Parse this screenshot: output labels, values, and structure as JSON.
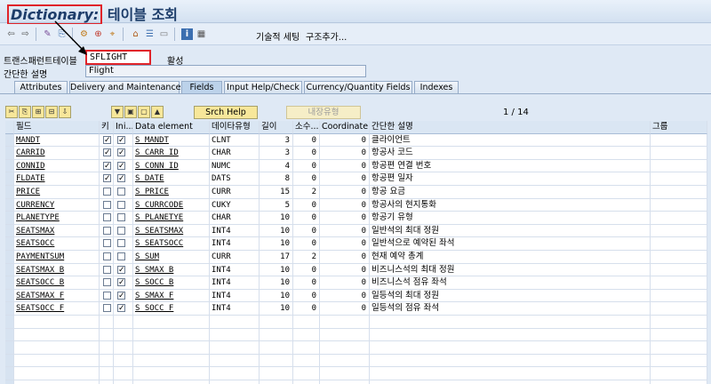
{
  "title": {
    "highlighted": "Dictionary:",
    "rest": " 테이블 조회"
  },
  "toolbar": {
    "icons": [
      "back-arrow-icon",
      "forward-arrow-icon",
      "edit-pen-icon",
      "display-change-icon",
      "activate-icon",
      "where-used-icon",
      "hierarchy-icon",
      "object-list-icon",
      "display-object-icon",
      "info-icon",
      "table-view-icon"
    ],
    "technical_settings": "기술적 세팅",
    "append_structure": "구조추가..."
  },
  "header_fields": {
    "transparent_table_label": "트랜스패런트테이블",
    "transparent_table_value": "SFLIGHT",
    "status": "활성",
    "short_desc_label": "간단한 설명",
    "short_desc_value": "Flight"
  },
  "tabs": [
    "Attributes",
    "Delivery and Maintenance",
    "Fields",
    "Input Help/Check",
    "Currency/Quantity Fields",
    "Indexes"
  ],
  "active_tab": "Fields",
  "table_toolbar": {
    "srch_help": "Srch Help",
    "builtin_type": "내장유형",
    "paging": "1  /  14"
  },
  "columns": [
    "필드",
    "키",
    "Ini...",
    "Data element",
    "데이타유형",
    "길이",
    "소수...",
    "Coordinate",
    "간단한 설명",
    "그룹"
  ],
  "rows": [
    {
      "field": "MANDT",
      "key": true,
      "init": true,
      "element": "S_MANDT",
      "type": "CLNT",
      "length": "3",
      "decimals": "0",
      "coord": "0",
      "desc": "클라이언트"
    },
    {
      "field": "CARRID",
      "key": true,
      "init": true,
      "element": "S_CARR_ID",
      "type": "CHAR",
      "length": "3",
      "decimals": "0",
      "coord": "0",
      "desc": "항공사 코드"
    },
    {
      "field": "CONNID",
      "key": true,
      "init": true,
      "element": "S_CONN_ID",
      "type": "NUMC",
      "length": "4",
      "decimals": "0",
      "coord": "0",
      "desc": "항공편 연결 번호"
    },
    {
      "field": "FLDATE",
      "key": true,
      "init": true,
      "element": "S_DATE",
      "type": "DATS",
      "length": "8",
      "decimals": "0",
      "coord": "0",
      "desc": "항공편 일자"
    },
    {
      "field": "PRICE",
      "key": false,
      "init": false,
      "element": "S_PRICE",
      "type": "CURR",
      "length": "15",
      "decimals": "2",
      "coord": "0",
      "desc": "항공 요금"
    },
    {
      "field": "CURRENCY",
      "key": false,
      "init": false,
      "element": "S_CURRCODE",
      "type": "CUKY",
      "length": "5",
      "decimals": "0",
      "coord": "0",
      "desc": "항공사의 현지통화"
    },
    {
      "field": "PLANETYPE",
      "key": false,
      "init": false,
      "element": "S_PLANETYE",
      "type": "CHAR",
      "length": "10",
      "decimals": "0",
      "coord": "0",
      "desc": "항공기 유형"
    },
    {
      "field": "SEATSMAX",
      "key": false,
      "init": false,
      "element": "S_SEATSMAX",
      "type": "INT4",
      "length": "10",
      "decimals": "0",
      "coord": "0",
      "desc": "일반석의 최대 정원"
    },
    {
      "field": "SEATSOCC",
      "key": false,
      "init": false,
      "element": "S_SEATSOCC",
      "type": "INT4",
      "length": "10",
      "decimals": "0",
      "coord": "0",
      "desc": "일반석으로 예약된 좌석"
    },
    {
      "field": "PAYMENTSUM",
      "key": false,
      "init": false,
      "element": "S_SUM",
      "type": "CURR",
      "length": "17",
      "decimals": "2",
      "coord": "0",
      "desc": "현재 예약 총계"
    },
    {
      "field": "SEATSMAX_B",
      "key": false,
      "init": true,
      "element": "S_SMAX_B",
      "type": "INT4",
      "length": "10",
      "decimals": "0",
      "coord": "0",
      "desc": "비즈니스석의 최대 정원"
    },
    {
      "field": "SEATSOCC_B",
      "key": false,
      "init": true,
      "element": "S_SOCC_B",
      "type": "INT4",
      "length": "10",
      "decimals": "0",
      "coord": "0",
      "desc": "비즈니스석 점유 좌석"
    },
    {
      "field": "SEATSMAX_F",
      "key": false,
      "init": true,
      "element": "S_SMAX_F",
      "type": "INT4",
      "length": "10",
      "decimals": "0",
      "coord": "0",
      "desc": "일등석의 최대 정원"
    },
    {
      "field": "SEATSOCC_F",
      "key": false,
      "init": true,
      "element": "S_SOCC_F",
      "type": "INT4",
      "length": "10",
      "decimals": "0",
      "coord": "0",
      "desc": "일등석의 점유 좌석"
    }
  ],
  "colors": {
    "highlight_box": "#e0242a",
    "grid_header": "#dae6f3",
    "background": "#dfe9f5"
  }
}
